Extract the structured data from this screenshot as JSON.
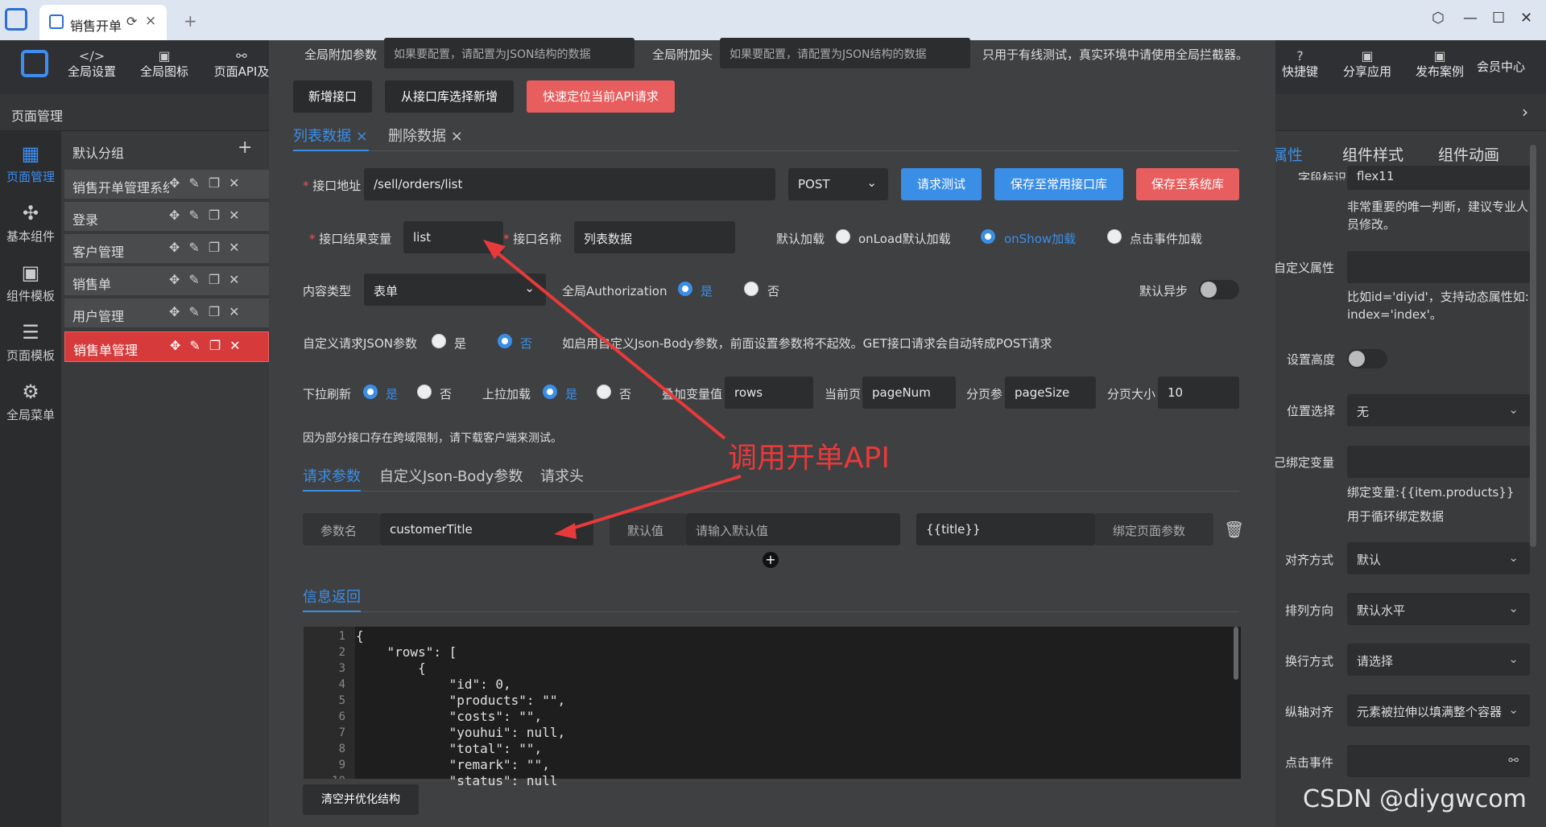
{
  "window": {
    "tab_title": "销售开单"
  },
  "toolbar": {
    "global_settings": "全局设置",
    "global_icons": "全局图标",
    "page_api": "页面API及",
    "shortcuts": "快捷键",
    "share_app": "分享应用",
    "publish_case": "发布案例",
    "member_center": "会员中心"
  },
  "page_bar": {
    "label": "页面管理"
  },
  "left_nav": [
    {
      "label": "页面管理"
    },
    {
      "label": "基本组件"
    },
    {
      "label": "组件模板"
    },
    {
      "label": "页面模板"
    },
    {
      "label": "全局菜单"
    }
  ],
  "page_list": {
    "group": "默认分组",
    "items": [
      "销售开单管理系统",
      "登录",
      "客户管理",
      "销售单",
      "用户管理",
      "销售单管理"
    ]
  },
  "dialog": {
    "global_params_label": "全局附加参数",
    "global_params_placeholder": "如果要配置，请配置为JSON结构的数据",
    "global_headers_label": "全局附加头",
    "global_headers_placeholder": "如果要配置，请配置为JSON结构的数据",
    "global_note": "只用于有线测试，真实环境中请使用全局拦截器。",
    "btn_add": "新增接口",
    "btn_from_lib": "从接口库选择新增",
    "btn_locate": "快速定位当前API请求",
    "tabs": [
      "列表数据",
      "删除数据"
    ],
    "api_url_label": "接口地址",
    "api_url": "/sell/orders/list",
    "method": "POST",
    "btn_test": "请求测试",
    "btn_save_common": "保存至常用接口库",
    "btn_save_sys": "保存至系统库",
    "result_var_label": "接口结果变量",
    "result_var": "list",
    "api_name_label": "接口名称",
    "api_name": "列表数据",
    "default_load_label": "默认加载",
    "load_opts": [
      "onLoad默认加载",
      "onShow加载",
      "点击事件加载"
    ],
    "content_type_label": "内容类型",
    "content_type": "表单",
    "auth_label": "全局Authorization",
    "yes": "是",
    "no": "否",
    "async_label": "默认异步",
    "custom_json_label": "自定义请求JSON参数",
    "custom_json_note": "如启用自定义Json-Body参数，前面设置参数将不起效。GET接口请求会自动转成POST请求",
    "pull_refresh_label": "下拉刷新",
    "pull_up_label": "上拉加载",
    "append_var_label": "叠加变量值",
    "append_var": "rows",
    "cur_page_label": "当前页",
    "cur_page": "pageNum",
    "page_param_label": "分页参",
    "page_param": "pageSize",
    "page_size_label": "分页大小",
    "page_size": "10",
    "cors_note": "因为部分接口存在跨域限制，请下载客户端来测试。",
    "param_tabs": [
      "请求参数",
      "自定义Json-Body参数",
      "请求头"
    ],
    "param_name_label": "参数名",
    "param_name": "customerTitle",
    "default_val_label": "默认值",
    "default_val_placeholder": "请输入默认值",
    "bind_val": "{{title}}",
    "bind_label": "绑定页面参数",
    "response_label": "信息返回",
    "btn_clear": "清空并优化结构",
    "code_lines": [
      "{",
      "    \"rows\": [",
      "        {",
      "            \"id\": 0,",
      "            \"products\": \"\",",
      "            \"costs\": \"\",",
      "            \"youhui\": null,",
      "            \"total\": \"\",",
      "            \"remark\": \"\",",
      "            \"status\": null"
    ]
  },
  "right_panel": {
    "tabs": [
      "属性",
      "组件样式",
      "组件动画"
    ],
    "field_id_label": "字段标识",
    "field_id": "flex11",
    "field_id_note": "非常重要的唯一判断，建议专业人员修改。",
    "custom_attr_label": "自定义属性",
    "custom_attr_note": "比如id='diyid'，支持动态属性如: index='index'。",
    "height_label": "设置高度",
    "position_label": "位置选择",
    "position": "无",
    "bind_var_label": "己绑定变量",
    "bind_var_note": "绑定变量:{{item.products}}",
    "bind_var_note2": "用于循环绑定数据",
    "align_label": "对齐方式",
    "align": "默认",
    "direction_label": "排列方向",
    "direction": "默认水平",
    "wrap_label": "换行方式",
    "wrap": "请选择",
    "cross_label": "纵轴对齐",
    "cross": "元素被拉伸以填满整个容器",
    "click_label": "点击事件"
  },
  "annotation": "调用开单API",
  "watermark": "CSDN @diygwcom"
}
